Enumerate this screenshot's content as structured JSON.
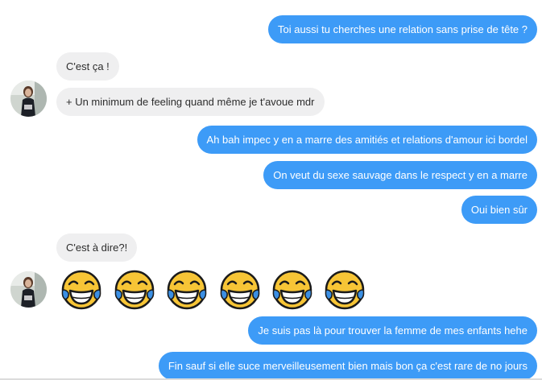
{
  "conversation": {
    "messages": [
      {
        "sender": "me",
        "text": "Toi aussi tu cherches une relation sans prise de tête ?"
      },
      {
        "sender": "them",
        "text": "C'est ça !"
      },
      {
        "sender": "them",
        "text": "+ Un minimum de feeling quand même je t'avoue mdr"
      },
      {
        "sender": "me",
        "text": "Ah bah impec y en a marre des amitiés et relations d'amour ici bordel"
      },
      {
        "sender": "me",
        "text": "On veut du sexe sauvage dans le respect y en a marre"
      },
      {
        "sender": "me",
        "text": "Oui bien sûr"
      },
      {
        "sender": "them",
        "text": "C'est à dire?!"
      },
      {
        "sender": "me",
        "text": "Je suis pas là pour trouver la femme de mes enfants hehe"
      },
      {
        "sender": "me",
        "text": "Fin sauf si elle suce merveilleusement bien mais bon ça c'est rare de no jours"
      }
    ],
    "emoji_message": {
      "sender": "them",
      "emoji": "face-with-tears-of-joy",
      "count": 6
    }
  },
  "colors": {
    "outgoing_bubble": "#3d9bf7",
    "incoming_bubble": "#efeff0",
    "emoji_face": "#f7c536"
  },
  "icons": {
    "avatar": "profile-photo-avatar",
    "emoji": "face-with-tears-of-joy-icon"
  }
}
